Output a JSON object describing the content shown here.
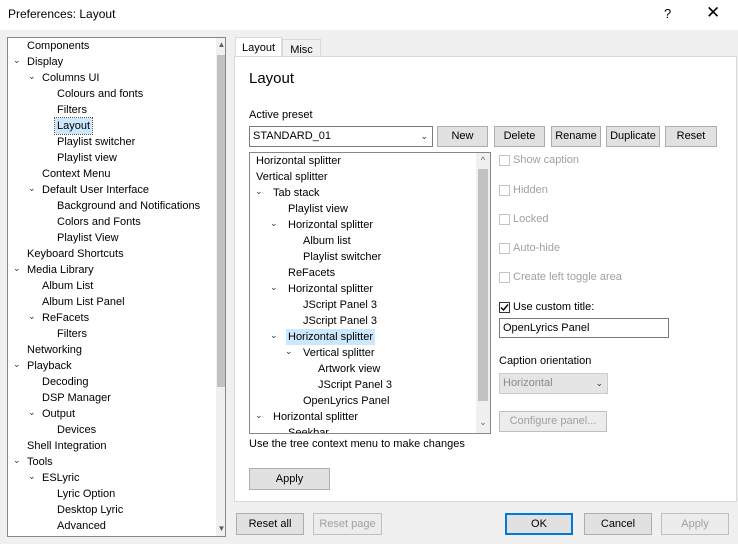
{
  "window": {
    "title": "Preferences: Layout",
    "help_glyph": "?",
    "close_glyph": "✕"
  },
  "nav_tree": [
    {
      "label": "Components",
      "depth": 0,
      "toggle": ""
    },
    {
      "label": "Display",
      "depth": 0,
      "toggle": "⌄"
    },
    {
      "label": "Columns UI",
      "depth": 1,
      "toggle": "⌄"
    },
    {
      "label": "Colours and fonts",
      "depth": 2,
      "toggle": ""
    },
    {
      "label": "Filters",
      "depth": 2,
      "toggle": ""
    },
    {
      "label": "Layout",
      "depth": 2,
      "toggle": "",
      "selected": true
    },
    {
      "label": "Playlist switcher",
      "depth": 2,
      "toggle": ""
    },
    {
      "label": "Playlist view",
      "depth": 2,
      "toggle": ""
    },
    {
      "label": "Context Menu",
      "depth": 1,
      "toggle": ""
    },
    {
      "label": "Default User Interface",
      "depth": 1,
      "toggle": "⌄"
    },
    {
      "label": "Background and Notifications",
      "depth": 2,
      "toggle": ""
    },
    {
      "label": "Colors and Fonts",
      "depth": 2,
      "toggle": ""
    },
    {
      "label": "Playlist View",
      "depth": 2,
      "toggle": ""
    },
    {
      "label": "Keyboard Shortcuts",
      "depth": 0,
      "toggle": ""
    },
    {
      "label": "Media Library",
      "depth": 0,
      "toggle": "⌄"
    },
    {
      "label": "Album List",
      "depth": 1,
      "toggle": ""
    },
    {
      "label": "Album List Panel",
      "depth": 1,
      "toggle": ""
    },
    {
      "label": "ReFacets",
      "depth": 1,
      "toggle": "⌄"
    },
    {
      "label": "Filters",
      "depth": 2,
      "toggle": ""
    },
    {
      "label": "Networking",
      "depth": 0,
      "toggle": ""
    },
    {
      "label": "Playback",
      "depth": 0,
      "toggle": "⌄"
    },
    {
      "label": "Decoding",
      "depth": 1,
      "toggle": ""
    },
    {
      "label": "DSP Manager",
      "depth": 1,
      "toggle": ""
    },
    {
      "label": "Output",
      "depth": 1,
      "toggle": "⌄"
    },
    {
      "label": "Devices",
      "depth": 2,
      "toggle": ""
    },
    {
      "label": "Shell Integration",
      "depth": 0,
      "toggle": ""
    },
    {
      "label": "Tools",
      "depth": 0,
      "toggle": "⌄"
    },
    {
      "label": "ESLyric",
      "depth": 1,
      "toggle": "⌄"
    },
    {
      "label": "Lyric Option",
      "depth": 2,
      "toggle": ""
    },
    {
      "label": "Desktop Lyric",
      "depth": 2,
      "toggle": ""
    },
    {
      "label": "Advanced",
      "depth": 2,
      "toggle": ""
    }
  ],
  "tabs": {
    "layout": "Layout",
    "misc": "Misc"
  },
  "page": {
    "heading": "Layout",
    "active_preset_label": "Active preset",
    "preset_value": "STANDARD_01",
    "buttons": {
      "new": "New",
      "delete": "Delete",
      "rename": "Rename",
      "duplicate": "Duplicate",
      "reset": "Reset"
    },
    "hint": "Use the tree context menu to make changes",
    "apply": "Apply"
  },
  "layout_tree": [
    {
      "label": "Horizontal splitter",
      "depth": 0,
      "toggle": ""
    },
    {
      "label": "Vertical splitter",
      "depth": 0,
      "toggle": "⌄"
    },
    {
      "label": "Tab stack",
      "depth": 1,
      "toggle": "⌄"
    },
    {
      "label": "Playlist view",
      "depth": 2,
      "toggle": ""
    },
    {
      "label": "Horizontal splitter",
      "depth": 2,
      "toggle": "⌄"
    },
    {
      "label": "Album list",
      "depth": 3,
      "toggle": ""
    },
    {
      "label": "Playlist switcher",
      "depth": 3,
      "toggle": ""
    },
    {
      "label": "ReFacets",
      "depth": 2,
      "toggle": ""
    },
    {
      "label": "Horizontal splitter",
      "depth": 2,
      "toggle": "⌄"
    },
    {
      "label": "JScript Panel 3",
      "depth": 3,
      "toggle": ""
    },
    {
      "label": "JScript Panel 3",
      "depth": 3,
      "toggle": ""
    },
    {
      "label": "Horizontal splitter",
      "depth": 2,
      "toggle": "⌄",
      "selected": true
    },
    {
      "label": "Vertical splitter",
      "depth": 3,
      "toggle": "⌄"
    },
    {
      "label": "Artwork view",
      "depth": 4,
      "toggle": ""
    },
    {
      "label": "JScript Panel 3",
      "depth": 4,
      "toggle": ""
    },
    {
      "label": "OpenLyrics Panel",
      "depth": 3,
      "toggle": ""
    },
    {
      "label": "Horizontal splitter",
      "depth": 1,
      "toggle": "⌄"
    },
    {
      "label": "Seekbar",
      "depth": 2,
      "toggle": ""
    }
  ],
  "options": {
    "show_caption": "Show caption",
    "hidden": "Hidden",
    "locked": "Locked",
    "auto_hide": "Auto-hide",
    "left_toggle": "Create left toggle area",
    "use_custom_title": "Use custom title:",
    "custom_title_value": "OpenLyrics Panel",
    "caption_orientation_label": "Caption orientation",
    "caption_orientation_value": "Horizontal",
    "configure_panel": "Configure panel..."
  },
  "footer": {
    "reset_all": "Reset all",
    "reset_page": "Reset page",
    "ok": "OK",
    "cancel": "Cancel",
    "apply": "Apply"
  }
}
